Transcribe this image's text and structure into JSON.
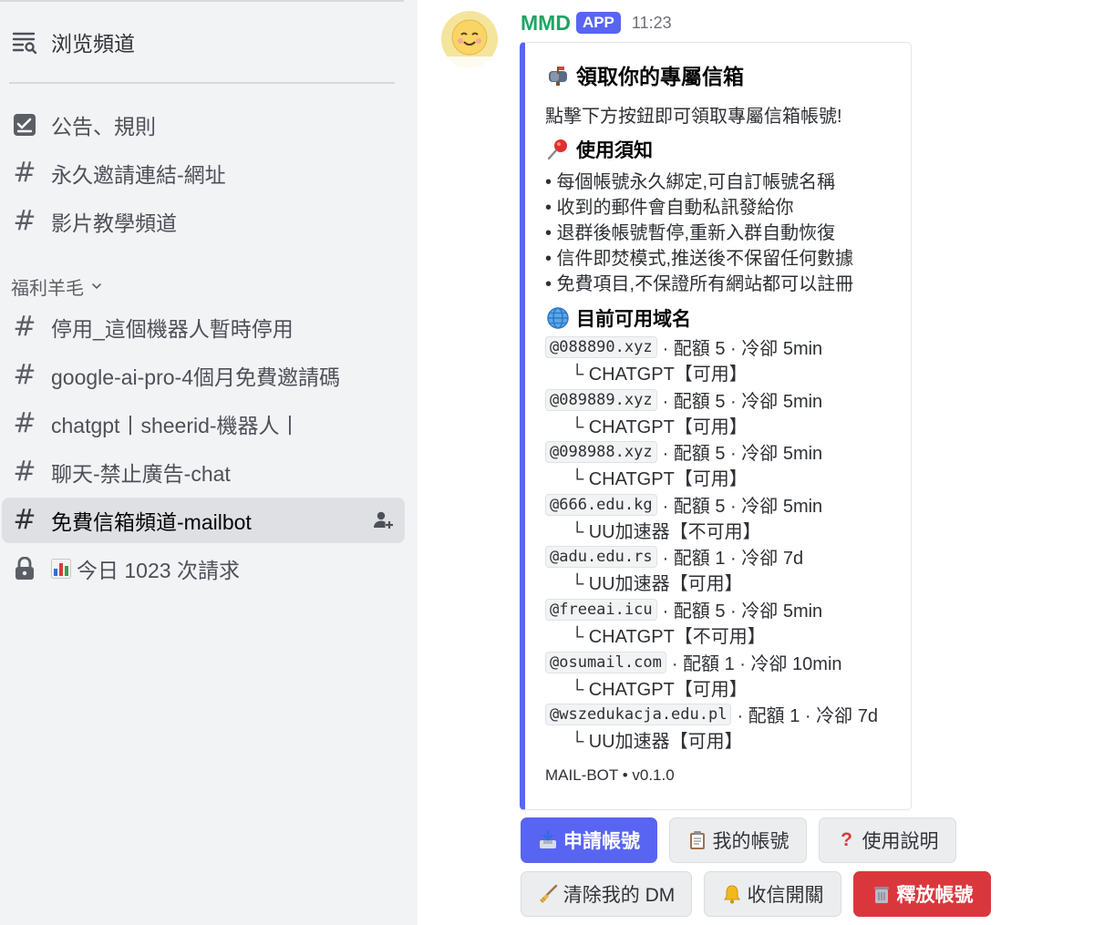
{
  "sidebar": {
    "browse_label": "浏览頻道",
    "pinned_channels": [
      {
        "label": "公告、規則",
        "icon": "checklist-icon"
      },
      {
        "label": "永久邀請連結-網址",
        "icon": "hash-icon"
      },
      {
        "label": "影片教學頻道",
        "icon": "hash-icon"
      }
    ],
    "category_label": "福利羊毛",
    "category_channels": [
      {
        "label": "停用_這個機器人暫時停用",
        "icon": "hash-icon"
      },
      {
        "label": "google-ai-pro-4個月免費邀請碼",
        "icon": "hash-icon"
      },
      {
        "label": "chatgpt丨sheerid-機器人丨",
        "icon": "hash-icon"
      },
      {
        "label": "聊天-禁止廣告-chat",
        "icon": "hash-icon"
      },
      {
        "label": "免費信箱頻道-mailbot",
        "icon": "hash-icon",
        "active": true
      },
      {
        "label": "今日 1023 次請求",
        "icon": "lock-icon"
      }
    ]
  },
  "message": {
    "author": "MMD",
    "badge": "APP",
    "timestamp": "11:23",
    "accent_color": "#5865f2",
    "author_color": "#1fa565"
  },
  "embed": {
    "title": "領取你的專屬信箱",
    "description": "點擊下方按鈕即可領取專屬信箱帳號!",
    "usage_title": "使用須知",
    "usage_items": [
      "• 每個帳號永久綁定,可自訂帳號名稱",
      "• 收到的郵件會自動私訊發給你",
      "• 退群後帳號暫停,重新入群自動恢復",
      "• 信件即焚模式,推送後不保留任何數據",
      "• 免費項目,不保證所有網站都可以註冊"
    ],
    "domains_title": "目前可用域名",
    "domains": [
      {
        "domain": "@088890.xyz",
        "meta": "· 配額 5 · 冷卻 5min",
        "sub": "└ CHATGPT【可用】"
      },
      {
        "domain": "@089889.xyz",
        "meta": "· 配額 5 · 冷卻 5min",
        "sub": "└ CHATGPT【可用】"
      },
      {
        "domain": "@098988.xyz",
        "meta": "· 配額 5 · 冷卻 5min",
        "sub": "└ CHATGPT【可用】"
      },
      {
        "domain": "@666.edu.kg",
        "meta": "· 配額 5 · 冷卻 5min",
        "sub": "└ UU加速器【不可用】"
      },
      {
        "domain": "@adu.edu.rs",
        "meta": "· 配額 1 · 冷卻 7d",
        "sub": "└ UU加速器【可用】"
      },
      {
        "domain": "@freeai.icu",
        "meta": "· 配額 5 · 冷卻 5min",
        "sub": "└ CHATGPT【不可用】"
      },
      {
        "domain": "@osumail.com",
        "meta": "· 配額 1 · 冷卻 10min",
        "sub": "└ CHATGPT【可用】"
      },
      {
        "domain": "@wszedukacja.edu.pl",
        "meta": "· 配額 1 · 冷卻 7d",
        "sub": "└ UU加速器【可用】"
      }
    ],
    "footer": "MAIL-BOT • v0.1.0"
  },
  "buttons": [
    {
      "label": "申請帳號",
      "icon": "inbox-tray-icon",
      "style": "primary"
    },
    {
      "label": "我的帳號",
      "icon": "clipboard-icon",
      "style": "secondary"
    },
    {
      "label": "使用說明",
      "icon": "question-icon",
      "style": "secondary"
    },
    {
      "label": "清除我的 DM",
      "icon": "broom-icon",
      "style": "secondary"
    },
    {
      "label": "收信開關",
      "icon": "bell-icon",
      "style": "secondary"
    },
    {
      "label": "釋放帳號",
      "icon": "wastebasket-icon",
      "style": "danger"
    }
  ]
}
